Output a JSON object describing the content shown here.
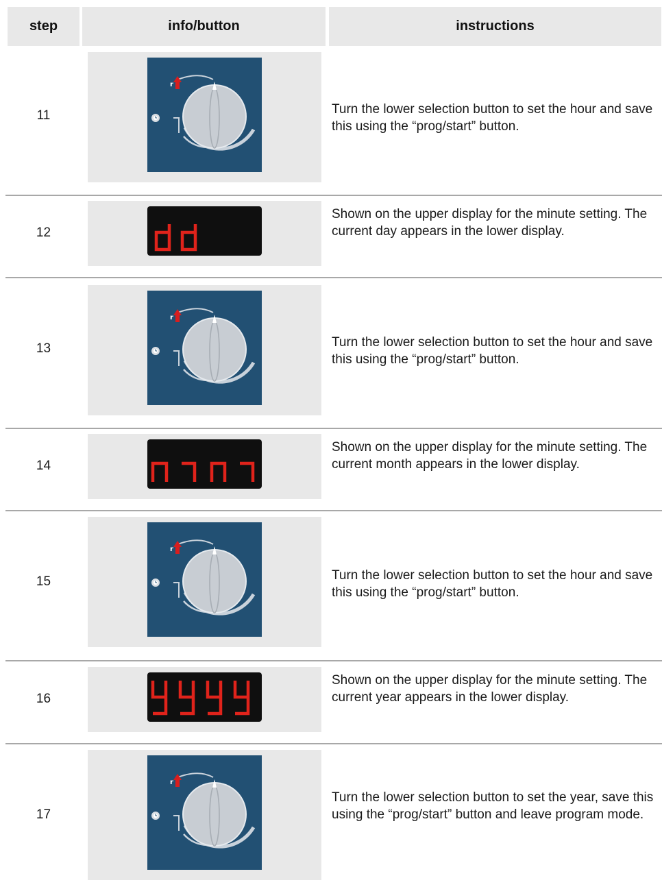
{
  "header": {
    "step": "step",
    "info": "info/button",
    "instructions": "instructions"
  },
  "rows": [
    {
      "step": "11",
      "type": "dial",
      "icon": "selector-dial",
      "text": "Turn the lower selection button to set the hour and save this using the “prog/start” button."
    },
    {
      "step": "12",
      "type": "display",
      "display_text": "dd",
      "text": "Shown on the upper display for the minute setting. The current day appears in the lower display."
    },
    {
      "step": "13",
      "type": "dial",
      "icon": "selector-dial",
      "text": "Turn the lower selection button to set the hour and save this using the “prog/start” button."
    },
    {
      "step": "14",
      "type": "display",
      "display_text": "mm",
      "text": "Shown on the upper display for the minute setting. The current month appears in the lower display."
    },
    {
      "step": "15",
      "type": "dial",
      "icon": "selector-dial",
      "text": "Turn the lower selection button to set the hour and save this using the “prog/start” button."
    },
    {
      "step": "16",
      "type": "display",
      "display_text": "yyyy",
      "text": "Shown on the upper display for the minute setting. The current year appears in the lower display."
    },
    {
      "step": "17",
      "type": "dial",
      "icon": "selector-dial",
      "text": "Turn the lower selection button to set the year, save this using the “prog/start” button and leave program mode."
    }
  ],
  "colors": {
    "dial_panel": "#225073",
    "display_bg": "#0f0f0f",
    "segment_red": "#e0231b",
    "cell_gray": "#e8e8e8"
  }
}
